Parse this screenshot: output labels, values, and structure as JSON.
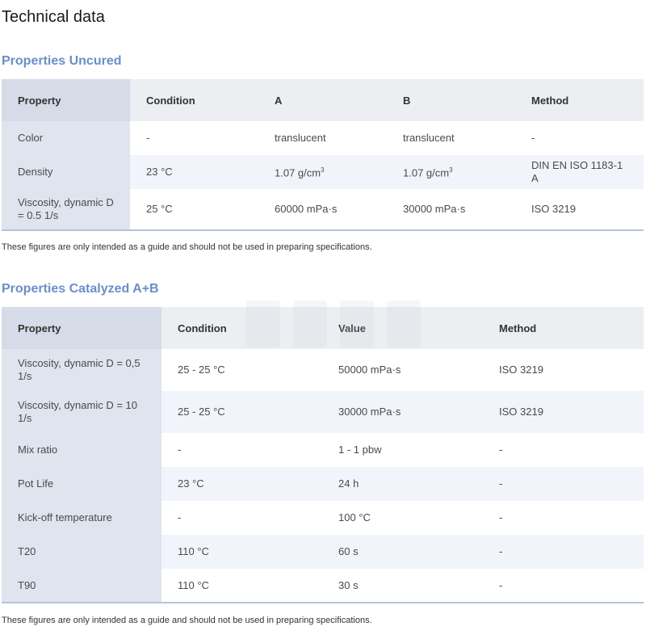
{
  "page": {
    "title": "Technical data"
  },
  "uncured": {
    "title": "Properties Uncured",
    "headers": [
      "Property",
      "Condition",
      "A",
      "B",
      "Method"
    ],
    "rows": [
      {
        "property": "Color",
        "condition": "-",
        "a": "translucent",
        "b": "translucent",
        "method": "-"
      },
      {
        "property": "Density",
        "condition": "23 °C",
        "a": "1.07 g/cm",
        "a_sup": "3",
        "b": "1.07 g/cm",
        "b_sup": "3",
        "method": "DIN EN ISO 1183-1 A"
      },
      {
        "property": "Viscosity, dynamic D = 0.5 1/s",
        "condition": "25 °C",
        "a": "60000 mPa·s",
        "b": "30000 mPa·s",
        "method": "ISO 3219"
      }
    ],
    "note": "These figures are only intended as a guide and should not be used in preparing specifications."
  },
  "catalyzed": {
    "title": "Properties Catalyzed A+B",
    "headers": [
      "Property",
      "Condition",
      "Value",
      "Method"
    ],
    "rows": [
      {
        "property": "Viscosity, dynamic D = 0,5 1/s",
        "condition": "25  -  25 °C",
        "value": "50000 mPa·s",
        "method": "ISO 3219"
      },
      {
        "property": "Viscosity, dynamic D = 10 1/s",
        "condition": "25  -  25 °C",
        "value": "30000 mPa·s",
        "method": "ISO 3219"
      },
      {
        "property": "Mix ratio",
        "condition": "-",
        "value": "1 - 1 pbw",
        "method": "-"
      },
      {
        "property": "Pot Life",
        "condition": "23 °C",
        "value": "24 h",
        "method": "-"
      },
      {
        "property": "Kick-off temperature",
        "condition": "-",
        "value": "100 °C",
        "method": "-"
      },
      {
        "property": "T20",
        "condition": "110 °C",
        "value": "60 s",
        "method": "-"
      },
      {
        "property": "T90",
        "condition": "110 °C",
        "value": "30 s",
        "method": "-"
      }
    ],
    "note": "These figures are only intended as a guide and should not be used in preparing specifications."
  }
}
